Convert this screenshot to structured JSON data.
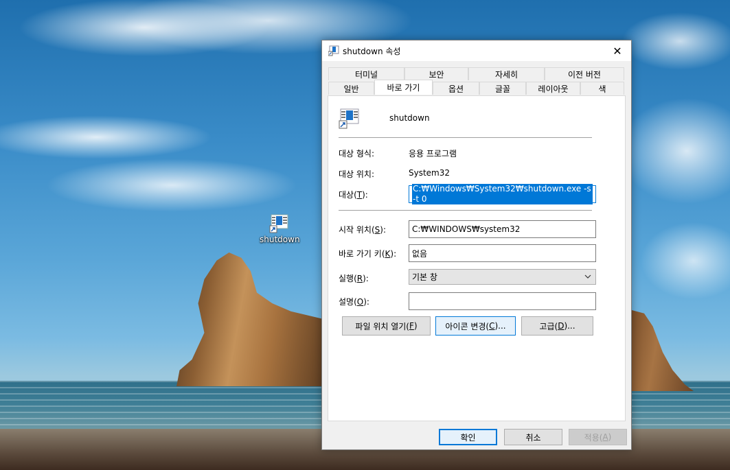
{
  "desktop": {
    "icon_label": "shutdown",
    "icon_name": "shortcut-app-icon"
  },
  "dialog": {
    "title": "shutdown 속성",
    "tabs_row1": [
      "터미널",
      "보안",
      "자세히",
      "이전 버전"
    ],
    "tabs_row2": [
      "일반",
      "바로 가기",
      "옵션",
      "글꼴",
      "레이아웃",
      "색"
    ],
    "active_tab": "바로 가기",
    "app_name": "shutdown",
    "fields": {
      "target_type_label": "대상 형식:",
      "target_type_value": "응용 프로그램",
      "target_location_label": "대상 위치:",
      "target_location_value": "System32",
      "target_label": "대상(",
      "target_label_key": "T",
      "target_label_end": "):",
      "target_value": "C:₩Windows₩System32₩shutdown.exe -s -t 0",
      "start_in_label": "시작 위치(",
      "start_in_key": "S",
      "start_in_end": "):",
      "start_in_value": "C:₩WINDOWS₩system32",
      "shortcut_key_label": "바로 가기 키(",
      "shortcut_key_key": "K",
      "shortcut_key_end": "):",
      "shortcut_key_value": "없음",
      "run_label": "실행(",
      "run_key": "R",
      "run_end": "):",
      "run_value": "기본 창",
      "comment_label": "설명(",
      "comment_key": "O",
      "comment_end": "):",
      "comment_value": ""
    },
    "buttons": {
      "open_location": "파일 위치 열기(",
      "open_location_key": "F",
      "open_location_end": ")",
      "change_icon": "아이콘 변경(",
      "change_icon_key": "C",
      "change_icon_end": ")...",
      "advanced": "고급(",
      "advanced_key": "D",
      "advanced_end": ")...",
      "ok": "확인",
      "cancel": "취소",
      "apply": "적용(",
      "apply_key": "A",
      "apply_end": ")"
    }
  },
  "colors": {
    "accent": "#0078d7",
    "dialog_bg": "#f0f0f0",
    "panel_bg": "#ffffff"
  }
}
